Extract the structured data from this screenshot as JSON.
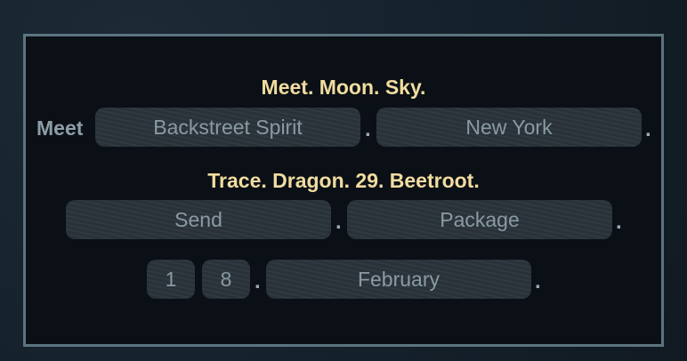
{
  "section1": {
    "heading": "Meet. Moon. Sky.",
    "prefix": "Meet",
    "box1": "Backstreet Spirit",
    "box2": "New York",
    "sep": "."
  },
  "section2": {
    "heading": "Trace. Dragon. 29. Beetroot.",
    "box1": "Send",
    "box2": "Package",
    "box3": "1",
    "box4": "8",
    "box5": "February",
    "sep": "."
  }
}
